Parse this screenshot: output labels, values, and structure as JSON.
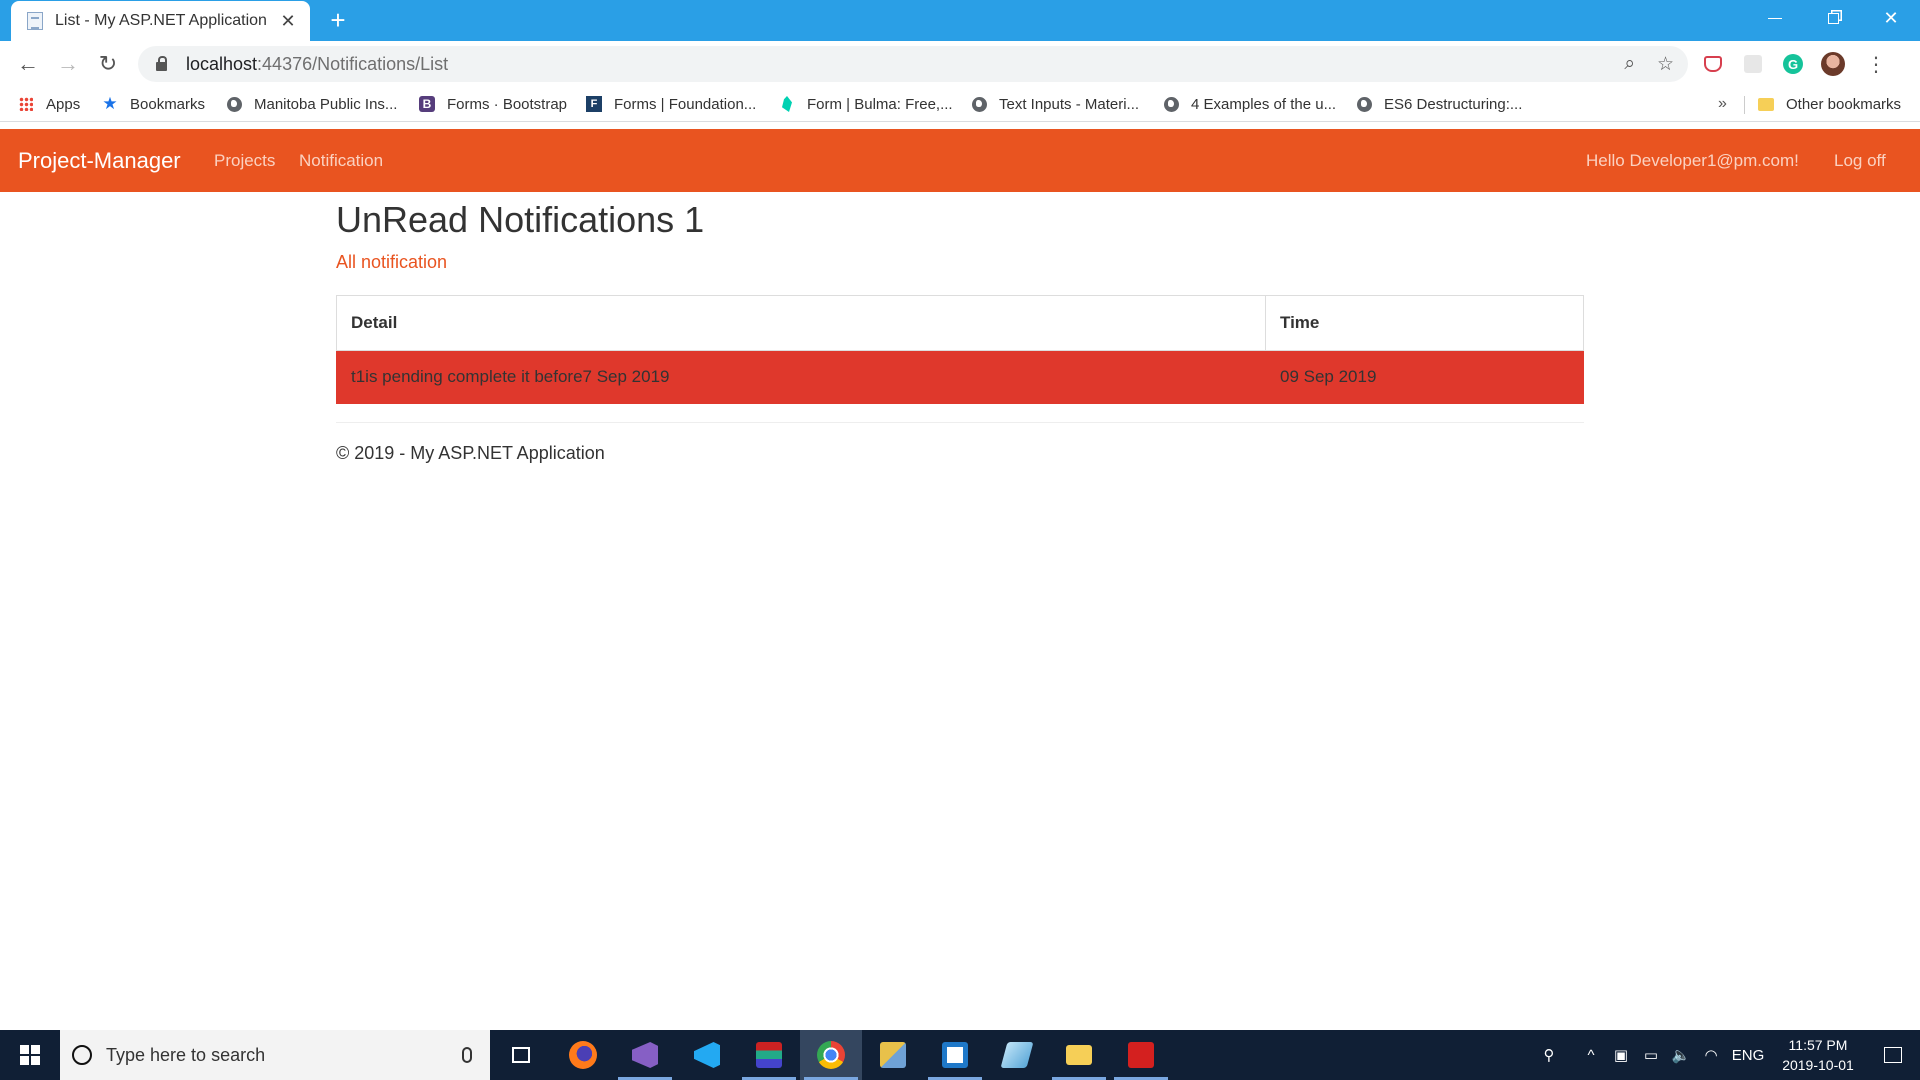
{
  "browser": {
    "tab_title": "List - My ASP.NET Application",
    "tab_close": "✕",
    "new_tab": "+",
    "url_host": "localhost",
    "url_path": ":44376/Notifications/List",
    "bookmarks": [
      {
        "label": "Apps",
        "icon": "apps-grid-icon"
      },
      {
        "label": "Bookmarks",
        "icon": "star-icon"
      },
      {
        "label": "Manitoba Public Ins...",
        "icon": "globe-icon"
      },
      {
        "label": "Forms · Bootstrap",
        "icon": "bootstrap-icon"
      },
      {
        "label": "Forms | Foundation...",
        "icon": "foundation-icon"
      },
      {
        "label": "Form | Bulma: Free,...",
        "icon": "bulma-icon"
      },
      {
        "label": "Text Inputs - Materi...",
        "icon": "globe-icon"
      },
      {
        "label": "4 Examples of the u...",
        "icon": "globe-icon"
      },
      {
        "label": "ES6 Destructuring:...",
        "icon": "globe-icon"
      }
    ],
    "bookmarks_overflow": "»",
    "other_bookmarks": "Other bookmarks",
    "grammarly_letter": "G"
  },
  "site": {
    "brand": "Project-Manager",
    "nav": {
      "projects": "Projects",
      "notification": "Notification",
      "greeting": "Hello Developer1@pm.com!",
      "logoff": "Log off"
    },
    "accent_color": "#e95420",
    "danger_color": "#df382c"
  },
  "main": {
    "title": "UnRead Notifications 1",
    "all_link": "All notification",
    "table": {
      "headers": {
        "detail": "Detail",
        "time": "Time"
      },
      "rows": [
        {
          "detail": "t1is pending complete it before7 Sep 2019",
          "time": "09 Sep 2019"
        }
      ]
    },
    "footer": "© 2019 - My ASP.NET Application"
  },
  "taskbar": {
    "search_placeholder": "Type here to search",
    "language": "ENG",
    "time": "11:57 PM",
    "date": "2019-10-01"
  }
}
